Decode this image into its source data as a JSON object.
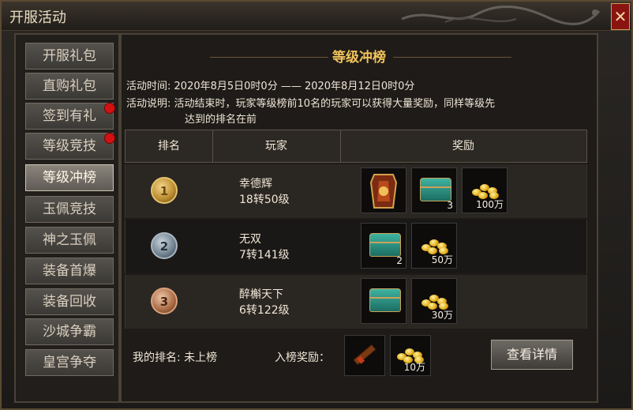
{
  "window": {
    "title": "开服活动",
    "close_label": "✕"
  },
  "sidebar": {
    "items": [
      {
        "label": "开服礼包",
        "active": false,
        "dot": false
      },
      {
        "label": "直购礼包",
        "active": false,
        "dot": false
      },
      {
        "label": "签到有礼",
        "active": false,
        "dot": true
      },
      {
        "label": "等级竞技",
        "active": false,
        "dot": true
      },
      {
        "label": "等级冲榜",
        "active": true,
        "dot": false
      },
      {
        "label": "玉佩竞技",
        "active": false,
        "dot": false
      },
      {
        "label": "神之玉佩",
        "active": false,
        "dot": false
      },
      {
        "label": "装备首爆",
        "active": false,
        "dot": false
      },
      {
        "label": "装备回收",
        "active": false,
        "dot": false
      },
      {
        "label": "沙城争霸",
        "active": false,
        "dot": false
      },
      {
        "label": "皇宫争夺",
        "active": false,
        "dot": false
      }
    ]
  },
  "main": {
    "heading": "等级冲榜",
    "time_label": "活动时间:",
    "time_value": "2020年8月5日0时0分 —— 2020年8月12日0时0分",
    "desc_label": "活动说明:",
    "desc_line1": "活动结束时，玩家等级榜前10名的玩家可以获得大量奖励，同样等级先",
    "desc_line2": "达到的排名在前",
    "columns": {
      "rank": "排名",
      "player": "玩家",
      "reward": "奖励"
    },
    "rows": [
      {
        "rank": "1",
        "name": "幸德辉",
        "level": "18转50级",
        "rewards": [
          {
            "icon": "token-icon",
            "qty": ""
          },
          {
            "icon": "chest-icon",
            "qty": "3"
          },
          {
            "icon": "gold-icon",
            "qty": "100万"
          }
        ]
      },
      {
        "rank": "2",
        "name": "无双",
        "level": "7转141级",
        "rewards": [
          {
            "icon": "chest-icon",
            "qty": "2"
          },
          {
            "icon": "gold-icon",
            "qty": "50万"
          }
        ]
      },
      {
        "rank": "3",
        "name": "醉槲天下",
        "level": "6转122级",
        "rewards": [
          {
            "icon": "chest-icon",
            "qty": ""
          },
          {
            "icon": "gold-icon",
            "qty": "30万"
          }
        ]
      }
    ],
    "footer": {
      "my_rank_label": "我的排名:",
      "my_rank_value": "未上榜",
      "entry_reward_label": "入榜奖励：",
      "entry_rewards": [
        {
          "icon": "firework-icon",
          "qty": ""
        },
        {
          "icon": "gold-icon",
          "qty": "10万"
        }
      ],
      "detail_button": "查看详情"
    }
  }
}
